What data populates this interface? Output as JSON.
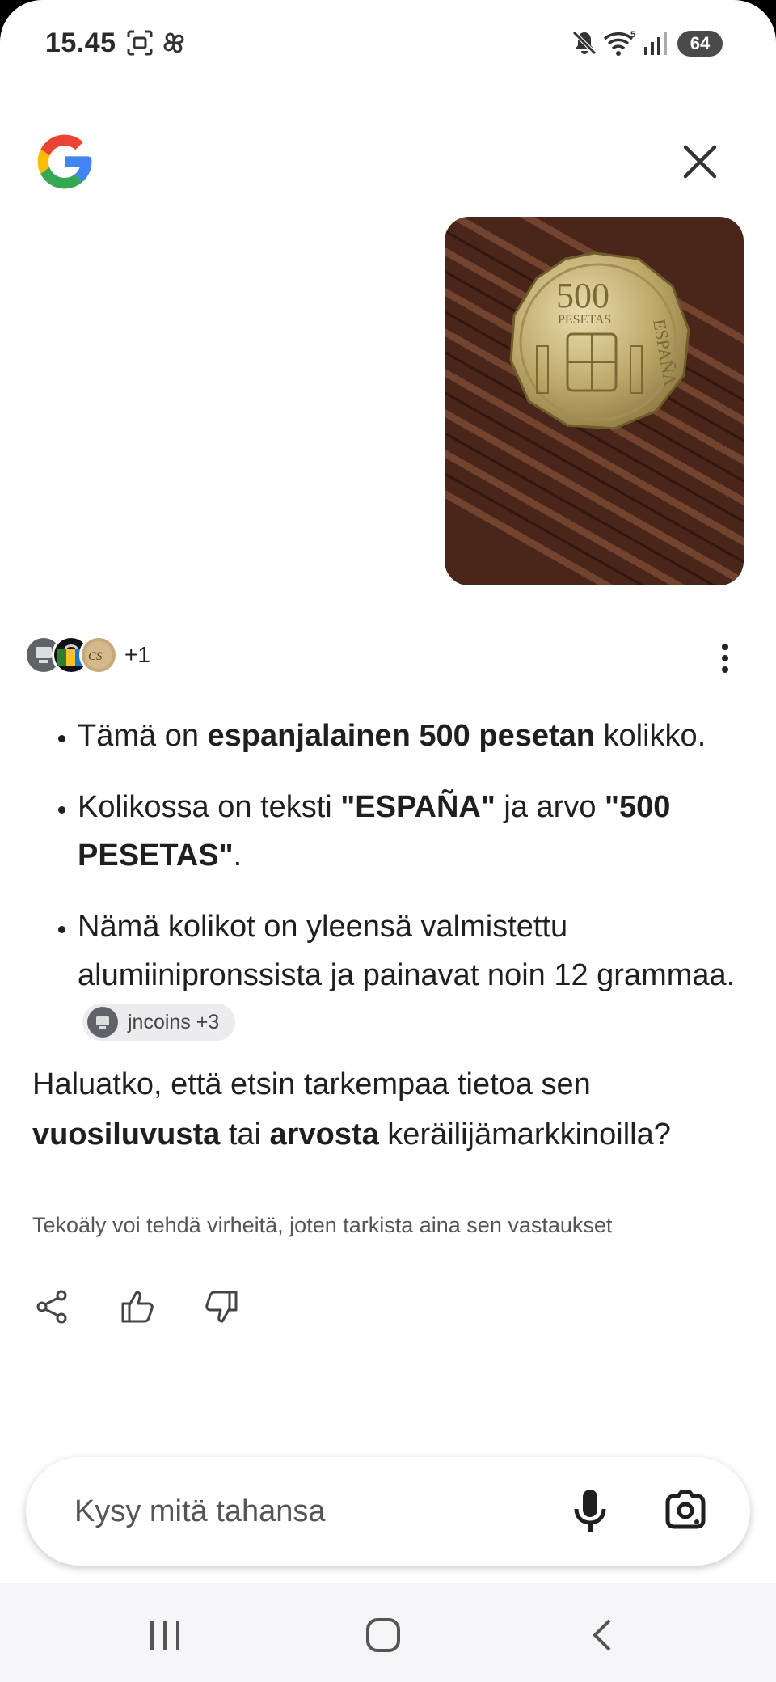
{
  "status_bar": {
    "time": "15.45",
    "battery": "64",
    "icons": [
      "screenshot-icon",
      "pinwheel-icon",
      "mute-icon",
      "wifi-icon",
      "signal-icon",
      "battery-icon"
    ]
  },
  "header": {
    "logo": "google-logo",
    "close_icon": "close-icon"
  },
  "image": {
    "subject": "coin-photo"
  },
  "sources": {
    "more": "+1"
  },
  "answer": {
    "bullet1": {
      "pre": "Tämä on ",
      "bold": "espanjalainen 500 pesetan",
      "post": " kolikko."
    },
    "bullet2": {
      "pre": "Kolikossa on teksti ",
      "bold1": "\"ESPAÑA\"",
      "mid": " ja arvo ",
      "bold2": "\"500 PESETAS\"",
      "post": "."
    },
    "bullet3": {
      "text": "Nämä kolikot on yleensä valmistettu alumiinipronssista ja painavat noin 12 grammaa.",
      "chip": "jncoins +3"
    }
  },
  "followup": {
    "pre": "Haluatko, että etsin tarkempaa tietoa sen ",
    "bold1": "vuosiluvusta",
    "mid": " tai ",
    "bold2": "arvosta",
    "post": " keräilijämarkkinoilla?"
  },
  "disclaimer": "Tekoäly voi tehdä virheitä, joten tarkista aina sen vastaukset",
  "actions": [
    "share-icon",
    "thumbs-up-icon",
    "thumbs-down-icon"
  ],
  "input": {
    "placeholder": "Kysy mitä tahansa",
    "value": ""
  },
  "colors": {
    "google_blue": "#4285F4",
    "google_red": "#EA4335",
    "google_yellow": "#FBBC05",
    "google_green": "#34A853",
    "text": "#1f1f1f"
  }
}
